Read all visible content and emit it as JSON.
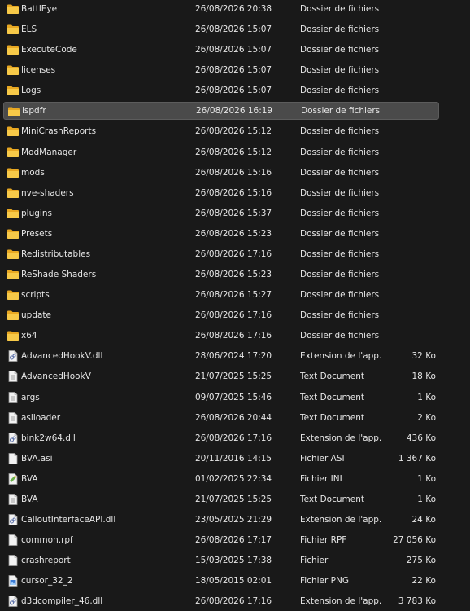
{
  "rows": [
    {
      "name": "BattlEye",
      "date": "26/08/2026 20:38",
      "type": "Dossier de fichiers",
      "size": "",
      "icon": "folder-icon"
    },
    {
      "name": "ELS",
      "date": "26/08/2026 15:07",
      "type": "Dossier de fichiers",
      "size": "",
      "icon": "folder-icon"
    },
    {
      "name": "ExecuteCode",
      "date": "26/08/2026 15:07",
      "type": "Dossier de fichiers",
      "size": "",
      "icon": "folder-icon"
    },
    {
      "name": "licenses",
      "date": "26/08/2026 15:07",
      "type": "Dossier de fichiers",
      "size": "",
      "icon": "folder-icon"
    },
    {
      "name": "Logs",
      "date": "26/08/2026 15:07",
      "type": "Dossier de fichiers",
      "size": "",
      "icon": "folder-icon"
    },
    {
      "name": "lspdfr",
      "date": "26/08/2026 16:19",
      "type": "Dossier de fichiers",
      "size": "",
      "icon": "folder-icon",
      "selected": true
    },
    {
      "name": "MiniCrashReports",
      "date": "26/08/2026 15:12",
      "type": "Dossier de fichiers",
      "size": "",
      "icon": "folder-icon"
    },
    {
      "name": "ModManager",
      "date": "26/08/2026 15:12",
      "type": "Dossier de fichiers",
      "size": "",
      "icon": "folder-icon"
    },
    {
      "name": "mods",
      "date": "26/08/2026 15:16",
      "type": "Dossier de fichiers",
      "size": "",
      "icon": "folder-icon"
    },
    {
      "name": "nve-shaders",
      "date": "26/08/2026 15:16",
      "type": "Dossier de fichiers",
      "size": "",
      "icon": "folder-icon"
    },
    {
      "name": "plugins",
      "date": "26/08/2026 15:37",
      "type": "Dossier de fichiers",
      "size": "",
      "icon": "folder-icon"
    },
    {
      "name": "Presets",
      "date": "26/08/2026 15:23",
      "type": "Dossier de fichiers",
      "size": "",
      "icon": "folder-icon"
    },
    {
      "name": "Redistributables",
      "date": "26/08/2026 17:16",
      "type": "Dossier de fichiers",
      "size": "",
      "icon": "folder-icon"
    },
    {
      "name": "ReShade Shaders",
      "date": "26/08/2026 15:23",
      "type": "Dossier de fichiers",
      "size": "",
      "icon": "folder-icon"
    },
    {
      "name": "scripts",
      "date": "26/08/2026 15:27",
      "type": "Dossier de fichiers",
      "size": "",
      "icon": "folder-icon"
    },
    {
      "name": "update",
      "date": "26/08/2026 17:16",
      "type": "Dossier de fichiers",
      "size": "",
      "icon": "folder-icon"
    },
    {
      "name": "x64",
      "date": "26/08/2026 17:16",
      "type": "Dossier de fichiers",
      "size": "",
      "icon": "folder-icon"
    },
    {
      "name": "AdvancedHookV.dll",
      "date": "28/06/2024 17:20",
      "type": "Extension de l'app...",
      "size": "32 Ko",
      "icon": "dll-icon"
    },
    {
      "name": "AdvancedHookV",
      "date": "21/07/2025 15:25",
      "type": "Text Document",
      "size": "18 Ko",
      "icon": "text-file-icon"
    },
    {
      "name": "args",
      "date": "09/07/2025 15:46",
      "type": "Text Document",
      "size": "1 Ko",
      "icon": "text-file-icon"
    },
    {
      "name": "asiloader",
      "date": "26/08/2026 20:44",
      "type": "Text Document",
      "size": "2 Ko",
      "icon": "text-file-icon"
    },
    {
      "name": "bink2w64.dll",
      "date": "26/08/2026 17:16",
      "type": "Extension de l'app...",
      "size": "436 Ko",
      "icon": "dll-icon"
    },
    {
      "name": "BVA.asi",
      "date": "20/11/2016 14:15",
      "type": "Fichier ASI",
      "size": "1 367 Ko",
      "icon": "file-icon"
    },
    {
      "name": "BVA",
      "date": "01/02/2025 22:34",
      "type": "Fichier INI",
      "size": "1 Ko",
      "icon": "ini-icon"
    },
    {
      "name": "BVA",
      "date": "21/07/2025 15:25",
      "type": "Text Document",
      "size": "1 Ko",
      "icon": "text-file-icon"
    },
    {
      "name": "CalloutInterfaceAPI.dll",
      "date": "23/05/2025 21:29",
      "type": "Extension de l'app...",
      "size": "24 Ko",
      "icon": "dll-icon"
    },
    {
      "name": "common.rpf",
      "date": "26/08/2026 17:17",
      "type": "Fichier RPF",
      "size": "27 056 Ko",
      "icon": "file-icon"
    },
    {
      "name": "crashreport",
      "date": "15/03/2025 17:38",
      "type": "Fichier",
      "size": "275 Ko",
      "icon": "file-icon"
    },
    {
      "name": "cursor_32_2",
      "date": "18/05/2015 02:01",
      "type": "Fichier PNG",
      "size": "22 Ko",
      "icon": "image-icon"
    },
    {
      "name": "d3dcompiler_46.dll",
      "date": "26/08/2026 17:16",
      "type": "Extension de l'app...",
      "size": "3 783 Ko",
      "icon": "dll-icon"
    }
  ],
  "colors": {
    "background": "#191919",
    "text": "#e6e6e6",
    "selected": "#4a4a4a",
    "folder": "#f4c542"
  }
}
